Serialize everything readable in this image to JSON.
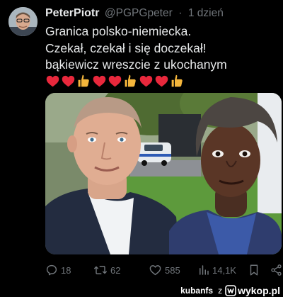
{
  "author": {
    "display_name": "PeterPiotr",
    "handle": "@PGPGpeter",
    "separator": "·",
    "timestamp": "1 dzień"
  },
  "tweet": {
    "lines": [
      "Granica polsko-niemiecka.",
      "Czekał, czekał i się doczekał!",
      "bąkiewicz wreszcie z ukochanym"
    ],
    "emoji": [
      "red-heart",
      "red-heart",
      "thumbs-up",
      "red-heart",
      "red-heart",
      "thumbs-up",
      "red-heart",
      "red-heart",
      "thumbs-up"
    ]
  },
  "actions": {
    "replies": "18",
    "retweets": "62",
    "likes": "585",
    "views": "14,1K"
  },
  "watermark": {
    "user": "kubanfs",
    "connector": "z",
    "site": "wykop.pl"
  },
  "colors": {
    "background": "#000000",
    "text": "#e7e9ea",
    "muted": "#71767b",
    "heart": "#e8283c",
    "thumb": "#f4b63c"
  }
}
